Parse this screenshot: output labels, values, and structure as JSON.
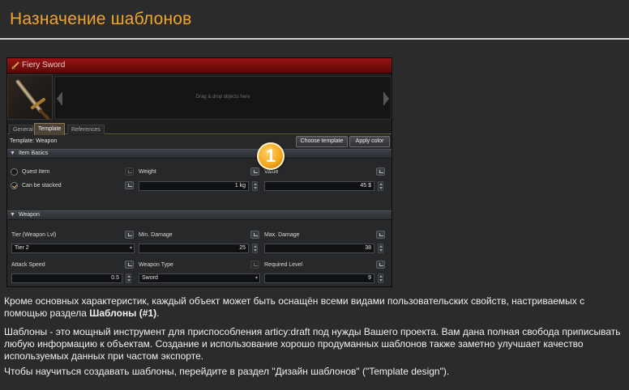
{
  "page": {
    "title": "Назначение шаблонов"
  },
  "app": {
    "window_title": "Fiery Sword",
    "dropzone_text": "Drag & drop objects here",
    "tabs": [
      {
        "label": "General",
        "active": false
      },
      {
        "label": "Template",
        "active": true
      },
      {
        "label": "References",
        "active": false
      }
    ],
    "template_label": "Template: Weapon",
    "buttons": {
      "choose_template": "Choose template",
      "apply_color": "Apply color"
    },
    "badge_number": "1",
    "item_basics": {
      "header": "Item Basics",
      "quest_item": {
        "label": "Quest Item",
        "checked": false
      },
      "can_be_stacked": {
        "label": "Can be stacked",
        "checked": true
      },
      "weight": {
        "label": "Weight",
        "value": "1 kg"
      },
      "value": {
        "label": "Value",
        "value": "45 $"
      }
    },
    "weapon": {
      "header": "Weapon",
      "tier": {
        "label": "Tier (Weapon Lvl)",
        "value": "Tier 2"
      },
      "min_damage": {
        "label": "Min. Damage",
        "value": "25"
      },
      "max_damage": {
        "label": "Max. Damage",
        "value": "38"
      },
      "attack_speed": {
        "label": "Attack Speed",
        "value": "0.5"
      },
      "weapon_type": {
        "label": "Weapon Type",
        "value": "Sword"
      },
      "required_level": {
        "label": "Required Level",
        "value": "9"
      }
    }
  },
  "body": {
    "p1_start": "Кроме основных характеристик, каждый объект может быть оснащён всеми видами пользовательских свойств, настриваемых с помощью раздела ",
    "p1_bold": "Шаблоны (#1)",
    "p1_end": ".",
    "p2": "Шаблоны - это мощный инструмент для приспособления articy:draft под нужды Вашего проекта. Вам дана полная свобода приписывать любую информацию к объектам. Создание и использование хорошо продуманных шаблонов также заметно улучшает качество используемых данных при частом экспорте.",
    "p3": "Чтобы научиться создавать шаблоны, перейдите в раздел \"Дизайн шаблонов\" (\"Template design\")."
  },
  "colors": {
    "heading": "#f0a62e",
    "background": "#2b2b2b",
    "badge": "#f2a41c",
    "titlebar": "#8b1010"
  }
}
